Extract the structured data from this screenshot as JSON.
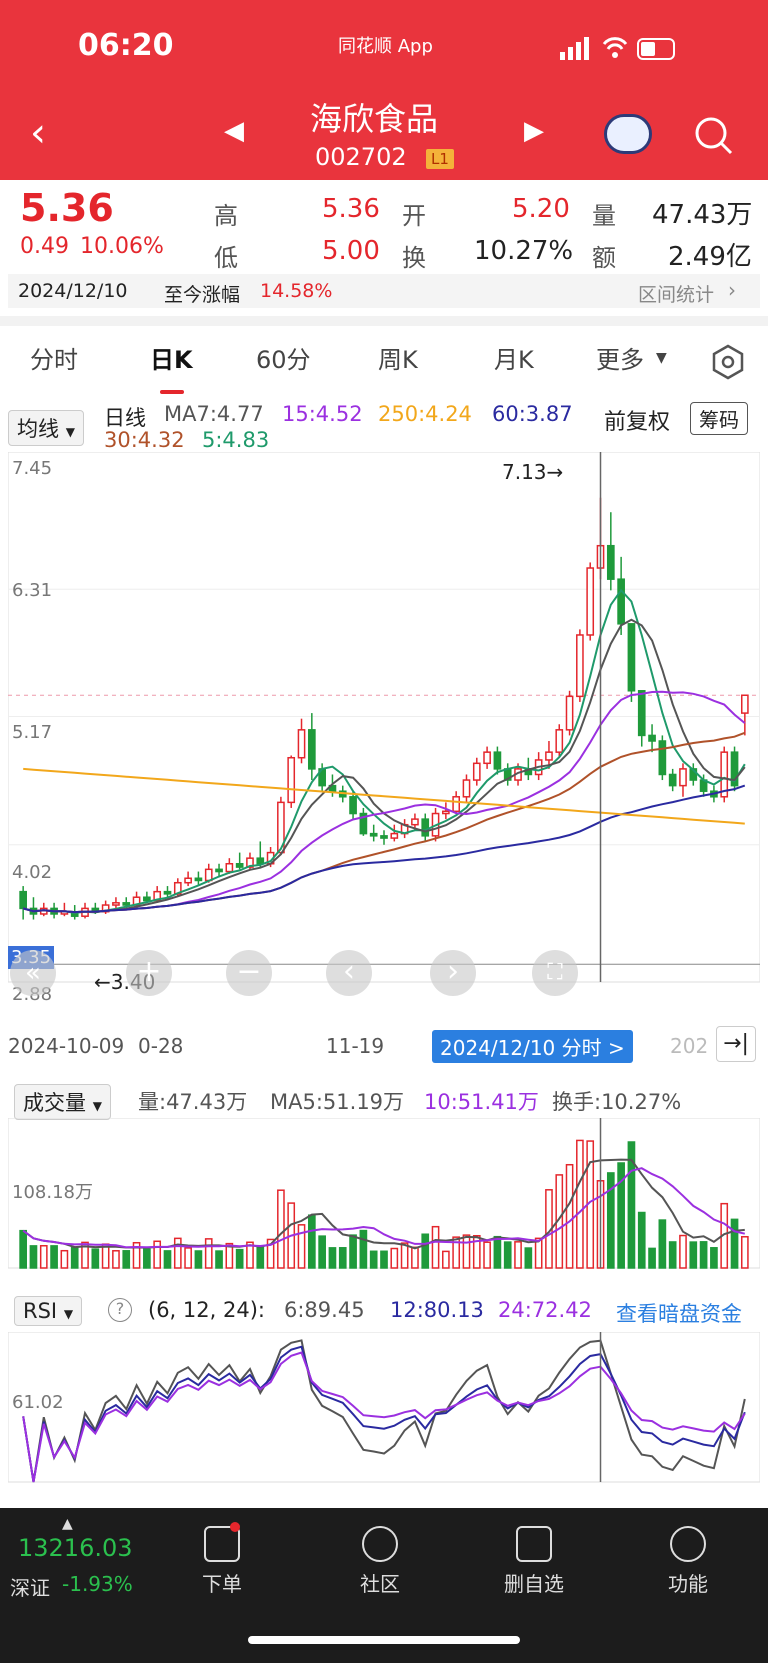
{
  "status_bar": {
    "time": "06:20",
    "app_label": "同花顺 App"
  },
  "header": {
    "stock_name": "海欣食品",
    "stock_code": "002702",
    "level_badge": "L1"
  },
  "quote": {
    "price": "5.36",
    "change": "0.49",
    "change_pct": "10.06%",
    "high_label": "高",
    "high": "5.36",
    "low_label": "低",
    "low": "5.00",
    "open_label": "开",
    "open": "5.20",
    "turnover_label": "换",
    "turnover": "10.27%",
    "volume_label": "量",
    "volume": "47.43万",
    "amount_label": "额",
    "amount": "2.49亿",
    "date": "2024/12/10",
    "since_label": "至今涨幅",
    "since_value": "14.58%",
    "range_stats": "区间统计"
  },
  "tabs": [
    "分时",
    "日K",
    "60分",
    "周K",
    "月K",
    "更多"
  ],
  "active_tab": "日K",
  "ma_legend": {
    "selector": "均线",
    "period": "日线",
    "ma7": "MA7:4.77",
    "ma15": "15:4.52",
    "ma250": "250:4.24",
    "ma60": "60:3.87",
    "ma30": "30:4.32",
    "ma5": "5:4.83",
    "adjust": "前复权",
    "chip_button": "筹码"
  },
  "price_axis": [
    "7.45",
    "6.31",
    "5.17",
    "4.02",
    "2.88"
  ],
  "annotations": {
    "high_marker": "7.13→",
    "low_marker": "←3.40",
    "left_tag": "3.35"
  },
  "date_axis": [
    "2024-10-09",
    "0-28",
    "11-19",
    "202"
  ],
  "date_pill": "2024/12/10 分时 >",
  "volume_panel": {
    "selector": "成交量",
    "vol": "量:47.43万",
    "ma5": "MA5:51.19万",
    "ma10": "10:51.41万",
    "turnover": "换手:10.27%",
    "axis_label": "108.18万"
  },
  "rsi_panel": {
    "selector": "RSI",
    "params": "(6, 12, 24):",
    "rsi6": "6:89.45",
    "rsi12": "12:80.13",
    "rsi24": "24:72.42",
    "link": "查看暗盘资金",
    "axis_label": "61.02"
  },
  "bottom": {
    "index_value": "13216.03",
    "index_name": "深证",
    "index_change": "-1.93%",
    "nav": [
      "下单",
      "社区",
      "删自选",
      "功能"
    ]
  },
  "colors": {
    "header": "#e9343d",
    "up": "#e4262c",
    "down": "#1f9a3b",
    "ma5": "#1f9a6b",
    "ma7": "#555555",
    "ma15": "#9b30e0",
    "ma30": "#b0522a",
    "ma60": "#2a2aa0",
    "ma250": "#f2a71b"
  },
  "chart_data": {
    "type": "candlestick",
    "dates_visible": [
      "2024-10-09",
      "11-19",
      "2024/12/10"
    ],
    "ylim": [
      2.88,
      7.45
    ],
    "candles": [
      [
        3.6,
        3.45,
        3.65,
        3.35
      ],
      [
        3.45,
        3.4,
        3.55,
        3.35
      ],
      [
        3.4,
        3.45,
        3.5,
        3.38
      ],
      [
        3.45,
        3.4,
        3.5,
        3.36
      ],
      [
        3.4,
        3.42,
        3.5,
        3.38
      ],
      [
        3.42,
        3.38,
        3.48,
        3.35
      ],
      [
        3.38,
        3.45,
        3.5,
        3.36
      ],
      [
        3.45,
        3.42,
        3.5,
        3.4
      ],
      [
        3.42,
        3.48,
        3.52,
        3.4
      ],
      [
        3.48,
        3.5,
        3.55,
        3.45
      ],
      [
        3.5,
        3.48,
        3.55,
        3.45
      ],
      [
        3.48,
        3.55,
        3.6,
        3.46
      ],
      [
        3.55,
        3.52,
        3.6,
        3.5
      ],
      [
        3.52,
        3.6,
        3.65,
        3.5
      ],
      [
        3.6,
        3.58,
        3.65,
        3.55
      ],
      [
        3.58,
        3.68,
        3.72,
        3.56
      ],
      [
        3.68,
        3.72,
        3.78,
        3.65
      ],
      [
        3.72,
        3.7,
        3.78,
        3.66
      ],
      [
        3.7,
        3.8,
        3.85,
        3.68
      ],
      [
        3.8,
        3.78,
        3.85,
        3.74
      ],
      [
        3.78,
        3.85,
        3.9,
        3.76
      ],
      [
        3.85,
        3.82,
        3.95,
        3.8
      ],
      [
        3.82,
        3.9,
        3.95,
        3.8
      ],
      [
        3.9,
        3.85,
        4.05,
        3.82
      ],
      [
        3.85,
        3.95,
        4.0,
        3.82
      ],
      [
        3.95,
        4.4,
        4.45,
        3.93
      ],
      [
        4.4,
        4.8,
        4.82,
        4.35
      ],
      [
        4.8,
        5.05,
        5.15,
        4.75
      ],
      [
        5.05,
        4.7,
        5.2,
        4.6
      ],
      [
        4.7,
        4.55,
        4.75,
        4.5
      ],
      [
        4.55,
        4.5,
        4.65,
        4.45
      ],
      [
        4.5,
        4.45,
        4.55,
        4.4
      ],
      [
        4.45,
        4.3,
        4.5,
        4.25
      ],
      [
        4.3,
        4.12,
        4.35,
        4.1
      ],
      [
        4.12,
        4.1,
        4.2,
        4.05
      ],
      [
        4.1,
        4.08,
        4.15,
        4.02
      ],
      [
        4.08,
        4.12,
        4.2,
        4.05
      ],
      [
        4.12,
        4.2,
        4.25,
        4.08
      ],
      [
        4.2,
        4.25,
        4.3,
        4.15
      ],
      [
        4.25,
        4.1,
        4.3,
        4.05
      ],
      [
        4.1,
        4.3,
        4.35,
        4.05
      ],
      [
        4.3,
        4.32,
        4.4,
        4.25
      ],
      [
        4.32,
        4.45,
        4.5,
        4.3
      ],
      [
        4.45,
        4.6,
        4.65,
        4.4
      ],
      [
        4.6,
        4.75,
        4.8,
        4.55
      ],
      [
        4.75,
        4.85,
        4.9,
        4.7
      ],
      [
        4.85,
        4.7,
        4.9,
        4.65
      ],
      [
        4.7,
        4.6,
        4.75,
        4.55
      ],
      [
        4.6,
        4.7,
        4.75,
        4.55
      ],
      [
        4.7,
        4.65,
        4.8,
        4.6
      ],
      [
        4.65,
        4.78,
        4.85,
        4.6
      ],
      [
        4.78,
        4.85,
        4.95,
        4.7
      ],
      [
        4.85,
        5.05,
        5.1,
        4.8
      ],
      [
        5.05,
        5.35,
        5.4,
        5.0
      ],
      [
        5.35,
        5.9,
        5.95,
        5.3
      ],
      [
        5.9,
        6.5,
        6.55,
        5.85
      ],
      [
        6.5,
        6.7,
        7.13,
        6.4
      ],
      [
        6.7,
        6.4,
        7.0,
        6.3
      ],
      [
        6.4,
        6.0,
        6.6,
        5.9
      ],
      [
        6.0,
        5.4,
        5.6,
        5.3
      ],
      [
        5.4,
        5.0,
        5.2,
        4.9
      ],
      [
        5.0,
        4.95,
        5.1,
        4.85
      ],
      [
        4.95,
        4.65,
        5.0,
        4.6
      ],
      [
        4.65,
        4.55,
        4.7,
        4.5
      ],
      [
        4.55,
        4.7,
        4.75,
        4.45
      ],
      [
        4.7,
        4.6,
        4.75,
        4.55
      ],
      [
        4.6,
        4.5,
        4.65,
        4.45
      ],
      [
        4.5,
        4.45,
        4.55,
        4.4
      ],
      [
        4.45,
        4.85,
        4.9,
        4.4
      ],
      [
        4.85,
        4.55,
        4.9,
        4.5
      ],
      [
        5.2,
        5.36,
        5.36,
        5.0
      ]
    ],
    "volume_ylim": [
      0,
      1.5
    ],
    "rsi_ylim": [
      20,
      100
    ]
  }
}
